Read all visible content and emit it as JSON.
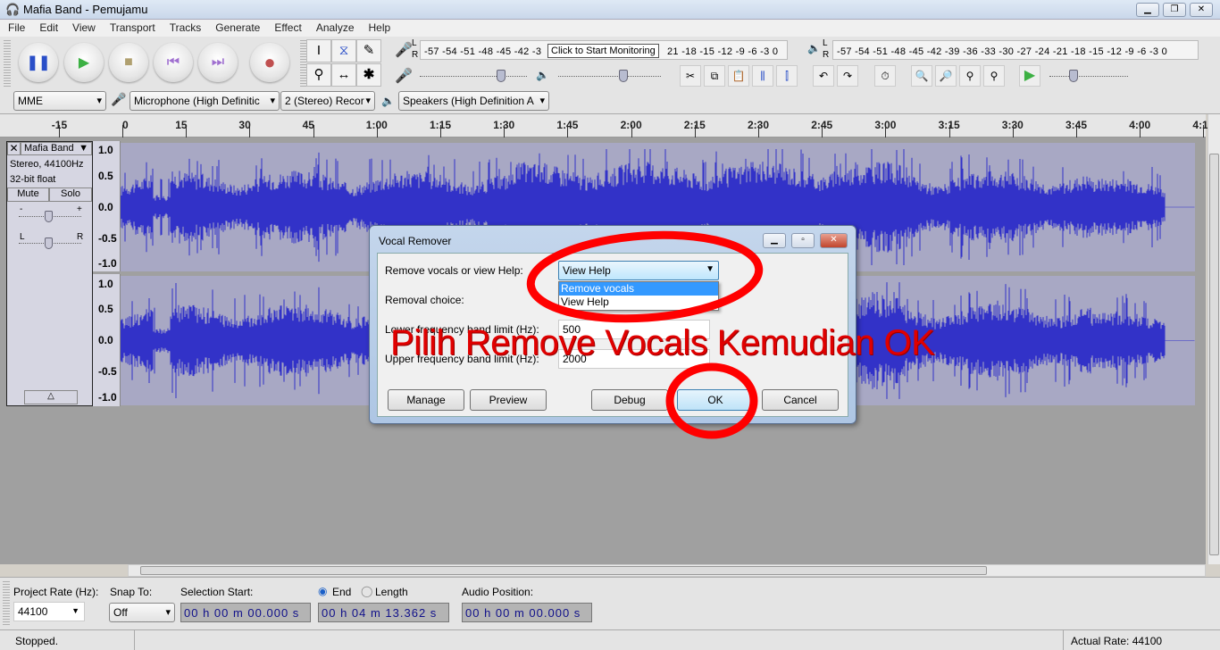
{
  "window": {
    "title": "Mafia Band - Pemujamu"
  },
  "menu": [
    "File",
    "Edit",
    "View",
    "Transport",
    "Tracks",
    "Generate",
    "Effect",
    "Analyze",
    "Help"
  ],
  "transport": {
    "icons": [
      "pause-icon",
      "play-icon",
      "stop-icon",
      "skip-start-icon",
      "skip-end-icon",
      "record-icon"
    ]
  },
  "tools": [
    "I",
    "⧖",
    "✎",
    "⚲",
    "↔",
    "✱"
  ],
  "meters": {
    "record_scale": "-57 -54 -51 -48 -45 -42 -3",
    "record_scale_right": "21 -18 -15 -12 -9 -6 -3 0",
    "tooltip": "Click to Start Monitoring",
    "playback_scale": "-57 -54 -51 -48 -45 -42 -39 -36 -33 -30 -27 -24 -21 -18 -15 -12 -9 -6 -3 0",
    "L": "L",
    "R": "R"
  },
  "devices": {
    "host": "MME",
    "mic": "Microphone (High Definitic",
    "channels": "2 (Stereo) Recor",
    "speakers": "Speakers (High Definition A"
  },
  "ruler": [
    "-15",
    "0",
    "15",
    "30",
    "45",
    "1:00",
    "1:15",
    "1:30",
    "1:45",
    "2:00",
    "2:15",
    "2:30",
    "2:45",
    "3:00",
    "3:15",
    "3:30",
    "3:45",
    "4:00",
    "4:15"
  ],
  "track": {
    "name": "Mafia Band",
    "info1": "Stereo, 44100Hz",
    "info2": "32-bit float",
    "mute": "Mute",
    "solo": "Solo",
    "gain_minus": "-",
    "gain_plus": "+",
    "pan_l": "L",
    "pan_r": "R",
    "scale": [
      "1.0",
      "0.5",
      "0.0",
      "-0.5",
      "-1.0"
    ],
    "wave_color": "#3232c8"
  },
  "dialog": {
    "title": "Vocal Remover",
    "label_mode": "Remove vocals or view Help:",
    "mode_value": "View Help",
    "options": [
      "Remove vocals",
      "View Help"
    ],
    "label_choice": "Removal choice:",
    "label_lower": "Lower frequency band limit (Hz):",
    "lower_value": "500",
    "label_upper": "Upper frequency band limit (Hz):",
    "upper_value": "2000",
    "buttons": {
      "manage": "Manage",
      "preview": "Preview",
      "debug": "Debug",
      "ok": "OK",
      "cancel": "Cancel"
    }
  },
  "annotation": {
    "text": "Pilih Remove Vocals Kemudian OK",
    "color": "#ff0000"
  },
  "selection_bar": {
    "rate_label": "Project Rate (Hz):",
    "rate_value": "44100",
    "snap_label": "Snap To:",
    "snap_value": "Off",
    "start_label": "Selection Start:",
    "end_label": "End",
    "length_label": "Length",
    "audio_pos_label": "Audio Position:",
    "start_value": "00 h 00 m 00.000 s",
    "end_value": "00 h 04 m 13.362 s",
    "audio_pos_value": "00 h 00 m 00.000 s"
  },
  "status": {
    "text": "Stopped.",
    "rate": "Actual Rate: 44100"
  }
}
